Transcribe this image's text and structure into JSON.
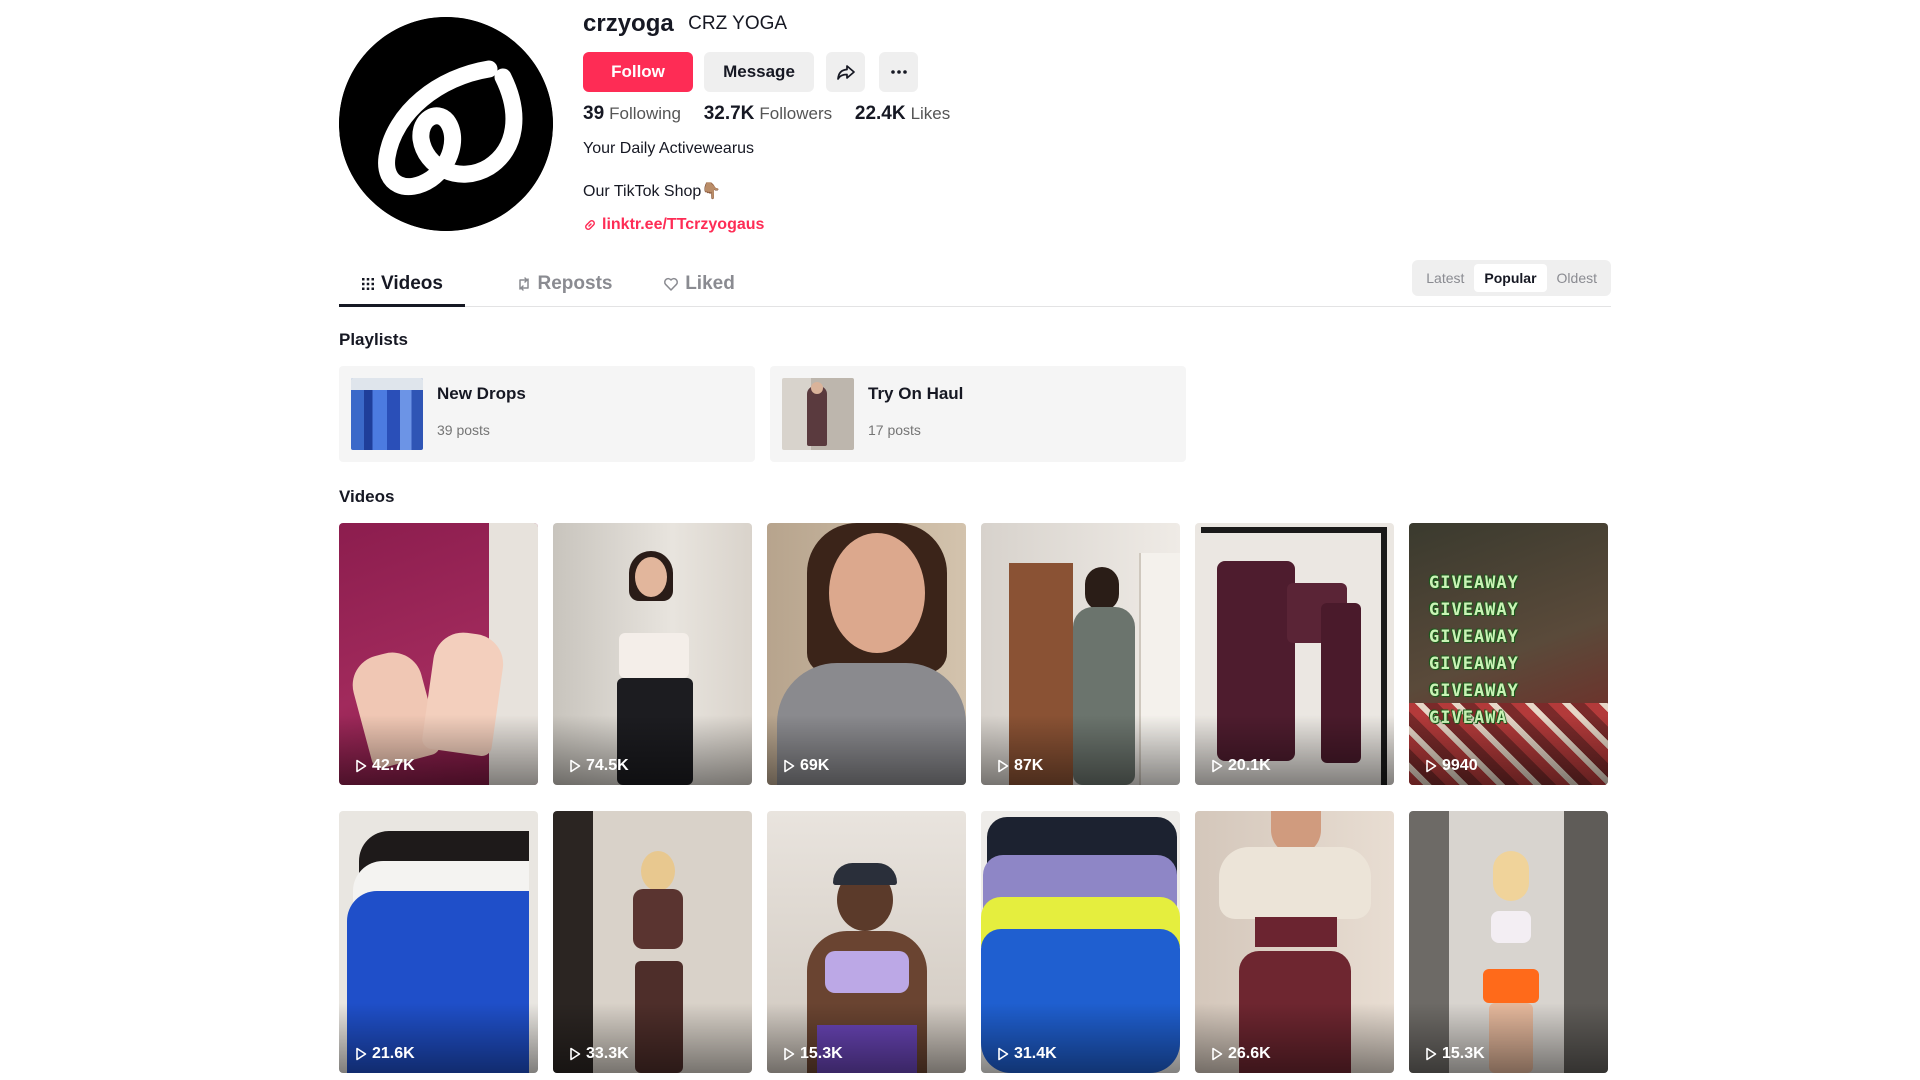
{
  "profile": {
    "username": "crzyoga",
    "nickname": "CRZ YOGA",
    "buttons": {
      "follow": "Follow",
      "message": "Message"
    },
    "stats": [
      {
        "value": "39",
        "label": "Following"
      },
      {
        "value": "32.7K",
        "label": "Followers"
      },
      {
        "value": "22.4K",
        "label": "Likes"
      }
    ],
    "bio_line1": "Your Daily Activewearus",
    "bio_line2": "Our TikTok Shop👇🏽",
    "link": "linktr.ee/TTcrzyogaus"
  },
  "tabs": [
    {
      "label": "Videos",
      "icon": "grid-icon",
      "active": true
    },
    {
      "label": "Reposts",
      "icon": "repost-icon",
      "active": false
    },
    {
      "label": "Liked",
      "icon": "heart-icon",
      "active": false
    }
  ],
  "sort": {
    "options": [
      "Latest",
      "Popular",
      "Oldest"
    ],
    "selected": "Popular"
  },
  "playlists_title": "Playlists",
  "playlists": [
    {
      "title": "New Drops",
      "count": "39 posts"
    },
    {
      "title": "Try On Haul",
      "count": "17 posts"
    }
  ],
  "videos_title": "Videos",
  "videos": [
    {
      "views": "42.7K"
    },
    {
      "views": "74.5K"
    },
    {
      "views": "69K"
    },
    {
      "views": "87K"
    },
    {
      "views": "20.1K"
    },
    {
      "views": "9940",
      "overlay_text": [
        "GIVEAWAY",
        "GIVEAWAY",
        "GIVEAWAY",
        "GIVEAWAY",
        "GIVEAWAY",
        "GIVEAWA"
      ]
    },
    {
      "views": "21.6K"
    },
    {
      "views": "33.3K"
    },
    {
      "views": "15.3K"
    },
    {
      "views": "31.4K"
    },
    {
      "views": "26.6K"
    },
    {
      "views": "15.3K"
    }
  ],
  "colors": {
    "accent": "#fe2c55",
    "text": "#161823",
    "muted": "#8a8b91"
  }
}
